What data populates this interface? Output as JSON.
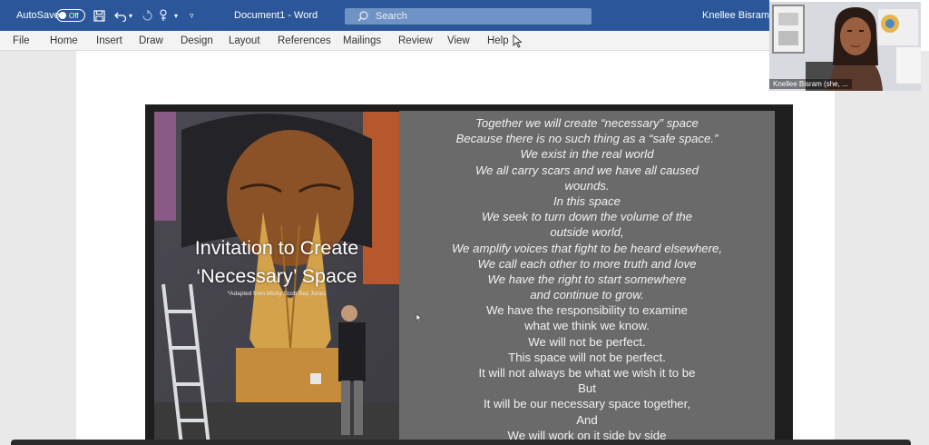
{
  "titlebar": {
    "autosave_label": "AutoSave",
    "autosave_state": "Off",
    "doc_title": "Document1  -  Word",
    "search_placeholder": "Search",
    "user_name": "Knellee Bisram"
  },
  "ribbon": {
    "tabs": [
      "File",
      "Home",
      "Insert",
      "Draw",
      "Design",
      "Layout",
      "References",
      "Mailings",
      "Review",
      "View",
      "Help"
    ]
  },
  "slide": {
    "title_line1": "Invitation to Create",
    "title_line2": "‘Necessary’ Space",
    "attribution": "*Adapted from Micky Scott Bey Jones",
    "poem": [
      "Together we will create “necessary” space",
      "Because there is no such thing as a “safe space.”",
      "We exist in the real world",
      "We all carry scars and we have all caused",
      "wounds.",
      "In this space",
      "We seek to turn down the volume of the",
      "outside world,",
      "We amplify voices that fight to be heard elsewhere,",
      "We call each other to more truth and love",
      "We have the right to start somewhere",
      "and continue to grow.",
      "We have the responsibility to examine",
      "what we think we know.",
      "We will not be perfect.",
      "This space will not be perfect.",
      "It will not always be what we wish it to be",
      "But",
      "It will be our necessary space together,",
      "And",
      "We will work on it side by side"
    ]
  },
  "video": {
    "participant_label": "Knellee Bisram (she, ..."
  },
  "colors": {
    "word_blue": "#2b579a",
    "ribbon_bg": "#f3f3f3",
    "slide_gray": "#6a6a6a"
  }
}
